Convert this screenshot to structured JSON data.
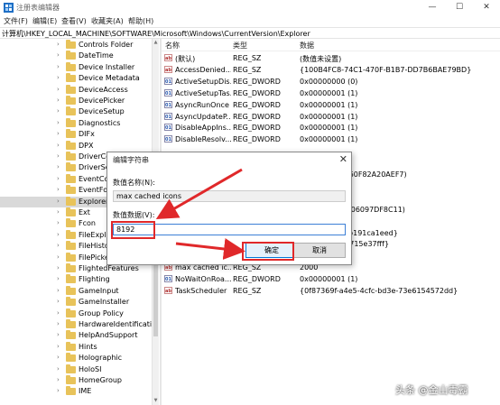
{
  "window": {
    "title": "注册表编辑器",
    "minimize_glyph": "—",
    "maximize_glyph": "☐",
    "close_glyph": "✕"
  },
  "menu": [
    "文件(F)",
    "编辑(E)",
    "查看(V)",
    "收藏夹(A)",
    "帮助(H)"
  ],
  "address": "计算机\\HKEY_LOCAL_MACHINE\\SOFTWARE\\Microsoft\\Windows\\CurrentVersion\\Explorer",
  "tree": {
    "items": [
      {
        "label": "Controls Folder",
        "selected": false
      },
      {
        "label": "DateTime",
        "selected": false
      },
      {
        "label": "Device Installer",
        "selected": false
      },
      {
        "label": "Device Metadata",
        "selected": false
      },
      {
        "label": "DeviceAccess",
        "selected": false
      },
      {
        "label": "DevicePicker",
        "selected": false
      },
      {
        "label": "DeviceSetup",
        "selected": false
      },
      {
        "label": "Diagnostics",
        "selected": false
      },
      {
        "label": "DIFx",
        "selected": false
      },
      {
        "label": "DPX",
        "selected": false
      },
      {
        "label": "DriverCo",
        "selected": false
      },
      {
        "label": "DriverSea",
        "selected": false
      },
      {
        "label": "EventColl",
        "selected": false
      },
      {
        "label": "EventForv",
        "selected": false
      },
      {
        "label": "Explorer",
        "selected": true
      },
      {
        "label": "Ext",
        "selected": false
      },
      {
        "label": "Fcon",
        "selected": false
      },
      {
        "label": "FileExplo",
        "selected": false
      },
      {
        "label": "FileHistor",
        "selected": false
      },
      {
        "label": "FilePicker",
        "selected": false
      },
      {
        "label": "FlightedFeatures",
        "selected": false
      },
      {
        "label": "Flighting",
        "selected": false
      },
      {
        "label": "GameInput",
        "selected": false
      },
      {
        "label": "GameInstaller",
        "selected": false
      },
      {
        "label": "Group Policy",
        "selected": false
      },
      {
        "label": "HardwareIdentification",
        "selected": false
      },
      {
        "label": "HelpAndSupport",
        "selected": false
      },
      {
        "label": "Hints",
        "selected": false
      },
      {
        "label": "Holographic",
        "selected": false
      },
      {
        "label": "HoloSI",
        "selected": false
      },
      {
        "label": "HomeGroup",
        "selected": false
      },
      {
        "label": "IME",
        "selected": false
      }
    ]
  },
  "list": {
    "columns": {
      "name": "名称",
      "type": "类型",
      "data": "数据"
    },
    "rows": [
      {
        "name": "(默认)",
        "type": "REG_SZ",
        "data": "(数值未设置)",
        "kind": "ab"
      },
      {
        "name": "AccessDenied...",
        "type": "REG_SZ",
        "data": "{100B4FC8-74C1-470F-B1B7-DD7B6BAE79BD}",
        "kind": "ab"
      },
      {
        "name": "ActiveSetupDis...",
        "type": "REG_DWORD",
        "data": "0x00000000 (0)",
        "kind": "bin"
      },
      {
        "name": "ActiveSetupTas...",
        "type": "REG_DWORD",
        "data": "0x00000001 (1)",
        "kind": "bin"
      },
      {
        "name": "AsyncRunOnce",
        "type": "REG_DWORD",
        "data": "0x00000001 (1)",
        "kind": "bin"
      },
      {
        "name": "AsyncUpdateP...",
        "type": "REG_DWORD",
        "data": "0x00000001 (1)",
        "kind": "bin"
      },
      {
        "name": "DisableAppIns...",
        "type": "REG_DWORD",
        "data": "0x00000001 (1)",
        "kind": "bin"
      },
      {
        "name": "DisableResolv...",
        "type": "REG_DWORD",
        "data": "0x00000001 (1)",
        "kind": "bin"
      },
      {
        "name": "",
        "type": "",
        "data": "",
        "kind": ""
      },
      {
        "name": "",
        "type": "",
        "data": "",
        "kind": ""
      },
      {
        "name": "",
        "type": "",
        "data": "a-4dde-A5A1-60F82A20AEF7)",
        "kind": ""
      },
      {
        "name": "",
        "type": "",
        "data": "00)",
        "kind": ""
      },
      {
        "name": "",
        "type": "",
        "data": "",
        "kind": ""
      },
      {
        "name": "",
        "type": "",
        "data": "-11D1-B2D2-006097DF8C11)",
        "kind": ""
      },
      {
        "name": "",
        "type": "",
        "data": "",
        "kind": ""
      },
      {
        "name": "",
        "type": "",
        "data": "4e47-ad57-3fb191ca1eed}",
        "kind": ""
      },
      {
        "name": "",
        "type": "",
        "data": "d8b-8c17-cd6715e37fff}",
        "kind": ""
      },
      {
        "name": "",
        "type": "",
        "data": "",
        "kind": ""
      },
      {
        "name": "max cached ic...",
        "type": "REG_SZ",
        "data": "2000",
        "kind": "ab"
      },
      {
        "name": "NoWaitOnRoa...",
        "type": "REG_DWORD",
        "data": "0x00000001 (1)",
        "kind": "bin"
      },
      {
        "name": "TaskScheduler",
        "type": "REG_SZ",
        "data": "{0f87369f-a4e5-4cfc-bd3e-73e6154572dd}",
        "kind": "ab"
      }
    ]
  },
  "dialog": {
    "title": "编辑字符串",
    "close_glyph": "✕",
    "name_label": "数值名称(N):",
    "name_value": "max cached icons",
    "data_label": "数值数据(V):",
    "data_value": "8192",
    "ok_label": "确定",
    "cancel_label": "取消"
  },
  "watermark": "头条 @金山毒霸",
  "colors": {
    "highlight": "#e0282a",
    "selection": "#d9d9d9",
    "accent": "#0078d7"
  }
}
